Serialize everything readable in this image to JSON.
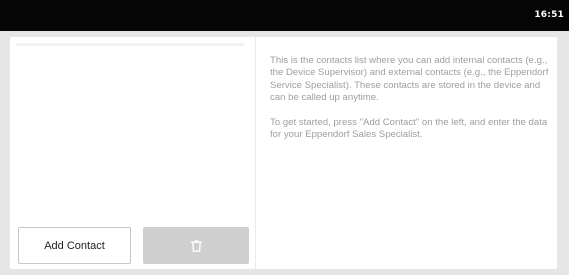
{
  "status_bar": {
    "time": "16:51"
  },
  "left_panel": {
    "add_contact_label": "Add Contact",
    "delete_icon": "trash-icon"
  },
  "info": {
    "paragraph1": "This is the contacts list where you can add internal contacts (e.g., the Device Supervisor) and external contacts (e.g., the Eppendorf Service Specialist). These contacts are stored in the device and can be called up anytime.",
    "paragraph2": "To get started, press \"Add Contact\" on the left, and enter the data for your Eppendorf Sales Specialist."
  },
  "colors": {
    "status_bar": "#050505",
    "background": "#e6e6e6",
    "panel": "#ffffff",
    "disabled_button": "#cfcfcf",
    "info_text": "#9e9e9e"
  }
}
